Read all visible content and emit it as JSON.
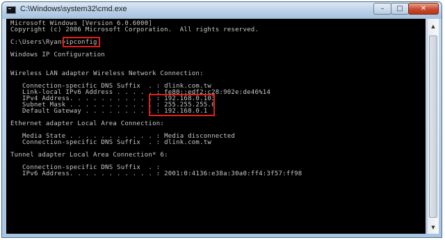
{
  "window": {
    "title": "C:\\Windows\\system32\\cmd.exe",
    "controls": {
      "minimize": "–",
      "maximize": "□",
      "close": "✕"
    }
  },
  "console": {
    "lines": [
      "Microsoft Windows [Version 6.0.6000]",
      "Copyright (c) 2006 Microsoft Corporation.  All rights reserved.",
      "",
      "C:\\Users\\Ryan>ipconfig",
      "",
      "Windows IP Configuration",
      "",
      "",
      "Wireless LAN adapter Wireless Network Connection:",
      "",
      "   Connection-specific DNS Suffix  . : dlink.com.tw",
      "   Link-local IPv6 Address . . . . . : fe80::edf2:c28:902e:de46%14",
      "   IPv4 Address. . . . . . . . . . . : 192.168.0.103",
      "   Subnet Mask . . . . . . . . . . . : 255.255.255.0",
      "   Default Gateway . . . . . . . . . : 192.168.0.1",
      "",
      "Ethernet adapter Local Area Connection:",
      "",
      "   Media State . . . . . . . . . . . : Media disconnected",
      "   Connection-specific DNS Suffix  . : dlink.com.tw",
      "",
      "Tunnel adapter Local Area Connection* 6:",
      "",
      "   Connection-specific DNS Suffix  . :",
      "   IPv6 Address. . . . . . . . . . . : 2001:0:4136:e38a:30a0:ff4:3f57:ff98"
    ]
  },
  "scrollbar": {
    "up_arrow": "▲",
    "down_arrow": "▼"
  },
  "colors": {
    "console_background": "#000000",
    "console_text": "#c8c8c8",
    "highlight_border": "#e0201a"
  }
}
